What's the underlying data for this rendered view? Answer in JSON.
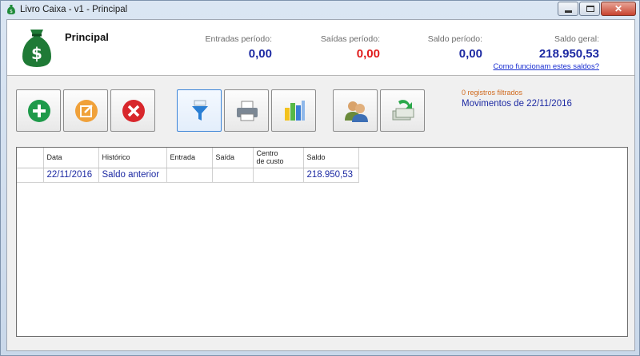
{
  "window": {
    "title": "Livro Caixa - v1 - Principal",
    "close_label": "✕"
  },
  "header": {
    "title": "Principal",
    "entradas": {
      "label": "Entradas período:",
      "value": "0,00"
    },
    "saidas": {
      "label": "Saídas período:",
      "value": "0,00"
    },
    "saldo_periodo": {
      "label": "Saldo período:",
      "value": "0,00"
    },
    "saldo_geral": {
      "label": "Saldo geral:",
      "value": "218.950,53"
    },
    "help_link": "Como funcionam estes saldos?"
  },
  "toolbar": {
    "buttons": [
      "add",
      "edit",
      "delete",
      "filter",
      "print",
      "chart",
      "users",
      "transfer"
    ],
    "active": "filter"
  },
  "status": {
    "filtered": "0 registros filtrados",
    "movements": "Movimentos de 22/11/2016"
  },
  "table": {
    "columns": [
      "Data",
      "Histórico",
      "Entrada",
      "Saída",
      "Centro de custo",
      "Saldo"
    ],
    "column_lines": {
      "centro_1": "Centro",
      "centro_2": "de custo"
    },
    "rows": [
      {
        "data": "22/11/2016",
        "historico": "Saldo anterior",
        "entrada": "",
        "saida": "",
        "centro": "",
        "saldo": "218.950,53"
      }
    ]
  },
  "colors": {
    "blue_value": "#1d2aa3",
    "red_value": "#e01b1b",
    "accent": "#3d85d8",
    "filter_info": "#d06a1e"
  }
}
